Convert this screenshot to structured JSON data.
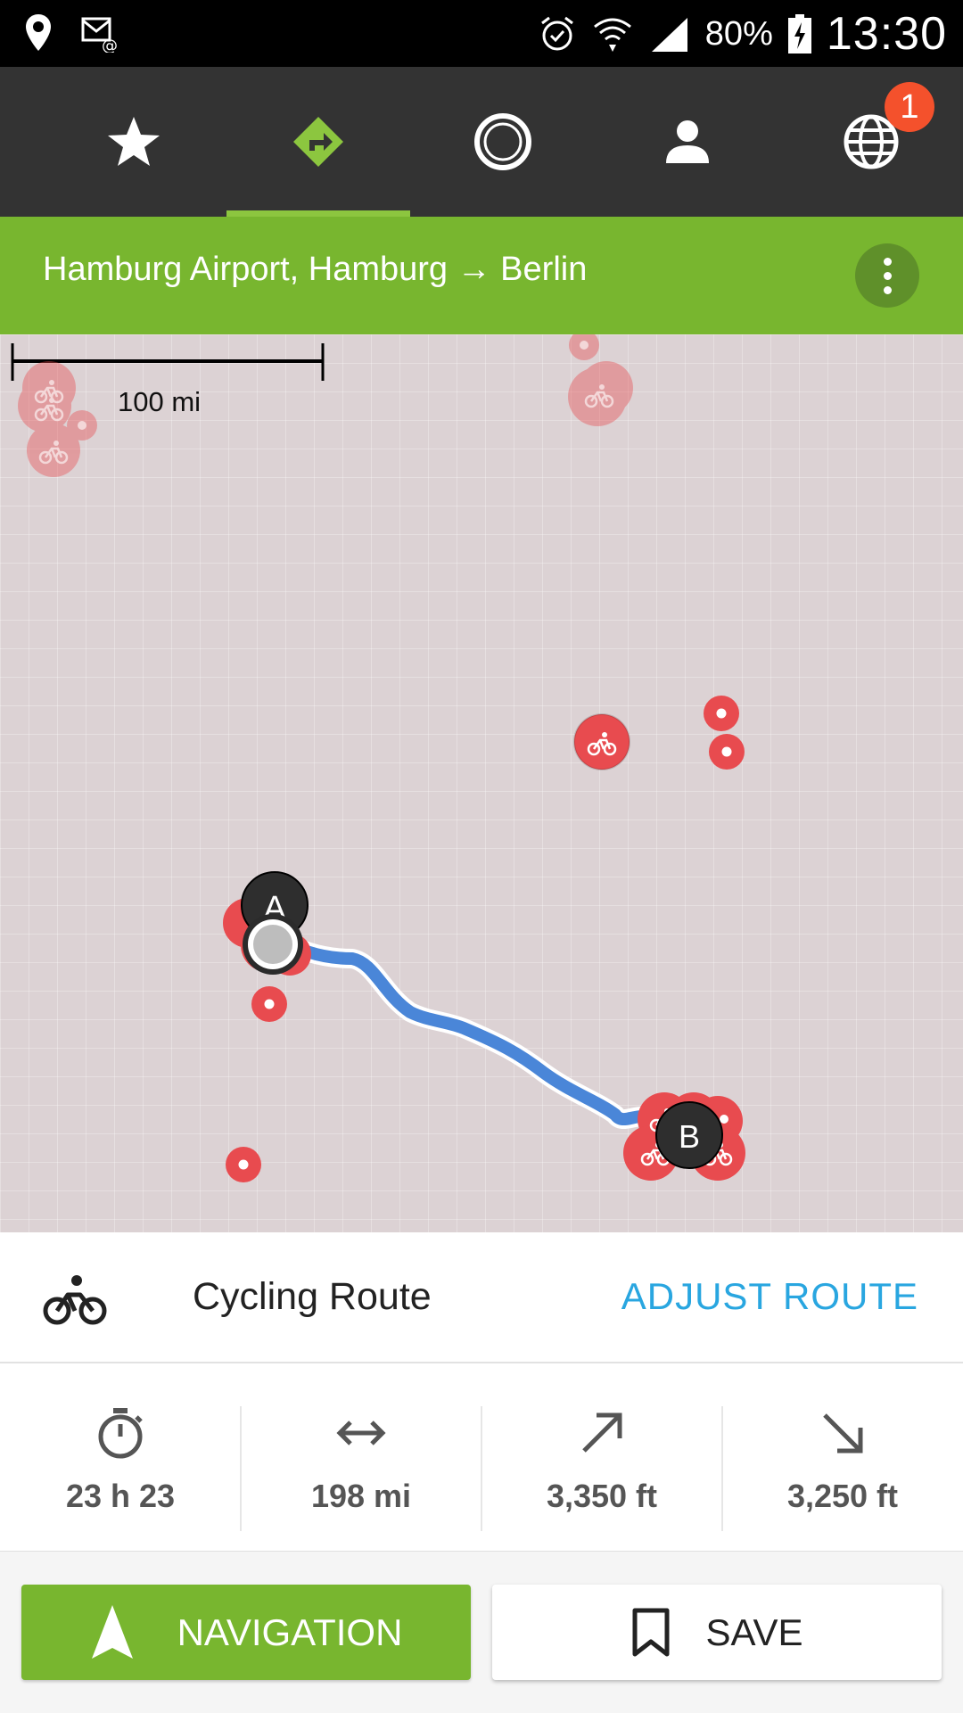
{
  "status_bar": {
    "battery": "80%",
    "time": "13:30"
  },
  "tabs": [
    {
      "icon": "star-icon"
    },
    {
      "icon": "route-directions-icon",
      "selected": true
    },
    {
      "icon": "circle-record-icon"
    },
    {
      "icon": "person-icon"
    },
    {
      "icon": "globe-icon",
      "badge": "1"
    }
  ],
  "route_header": {
    "title": "Hamburg Airport, Hamburg → Berlin"
  },
  "map": {
    "scale_label": "100 mi",
    "marker_start": "A",
    "marker_end": "B"
  },
  "route_info": {
    "title": "Cycling Route",
    "adjust_label": "ADJUST ROUTE"
  },
  "stats": {
    "duration": "23 h 23",
    "distance": "198 mi",
    "elevation_up": "3,350 ft",
    "elevation_down": "3,250 ft"
  },
  "actions": {
    "navigation_label": "NAVIGATION",
    "save_label": "SAVE"
  },
  "colors": {
    "accent_green": "#78b62f",
    "active_tab_green": "#8cc63f",
    "route_blue": "#4a86d8",
    "poi_red": "#e84b4f",
    "link_blue": "#29a6e0",
    "badge_orange": "#f4512c"
  }
}
